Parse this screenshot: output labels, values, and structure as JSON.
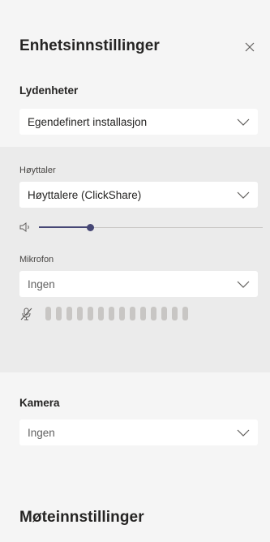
{
  "panel": {
    "title": "Enhetsinnstillinger",
    "close_icon": "close-icon"
  },
  "audio": {
    "label": "Lydenheter",
    "selected": "Egendefinert installasjon"
  },
  "speaker": {
    "label": "Høyttaler",
    "selected": "Høyttalere (ClickShare)",
    "volume": 0.23
  },
  "microphone": {
    "label": "Mikrofon",
    "selected": "Ingen",
    "level_bars": 14,
    "level": 0
  },
  "camera": {
    "label": "Kamera",
    "selected": "Ingen"
  },
  "meeting": {
    "title": "Møteinnstillinger"
  },
  "colors": {
    "accent": "#464775",
    "panel_bg": "#f5f5f5",
    "band_bg": "#ebebeb"
  }
}
